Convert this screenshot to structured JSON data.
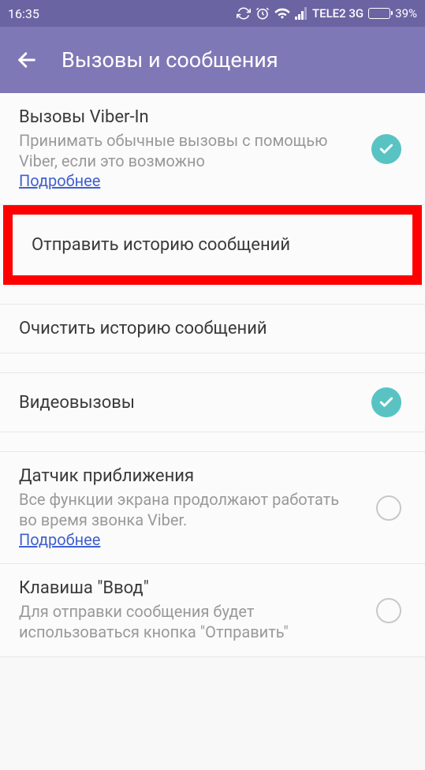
{
  "status_bar": {
    "time": "16:35",
    "carrier": "TELE2 3G",
    "battery": "39%"
  },
  "toolbar": {
    "title": "Вызовы и сообщения"
  },
  "settings": {
    "viber_in": {
      "title": "Вызовы Viber-In",
      "subtitle": "Принимать обычные вызовы с помощью Viber, если это возможно",
      "link": "Подробнее",
      "checked": true
    },
    "send_history": {
      "title": "Отправить историю сообщений"
    },
    "clear_history": {
      "title": "Очистить историю сообщений"
    },
    "video_calls": {
      "title": "Видеовызовы",
      "checked": true
    },
    "proximity": {
      "title": "Датчик приближения",
      "subtitle": "Все функции экрана продолжают работать во время звонка Viber.",
      "link": "Подробнее",
      "checked": false
    },
    "enter_key": {
      "title": "Клавиша \"Ввод\"",
      "subtitle": "Для отправки сообщения будет использоваться кнопка \"Отправить\"",
      "checked": false
    }
  }
}
